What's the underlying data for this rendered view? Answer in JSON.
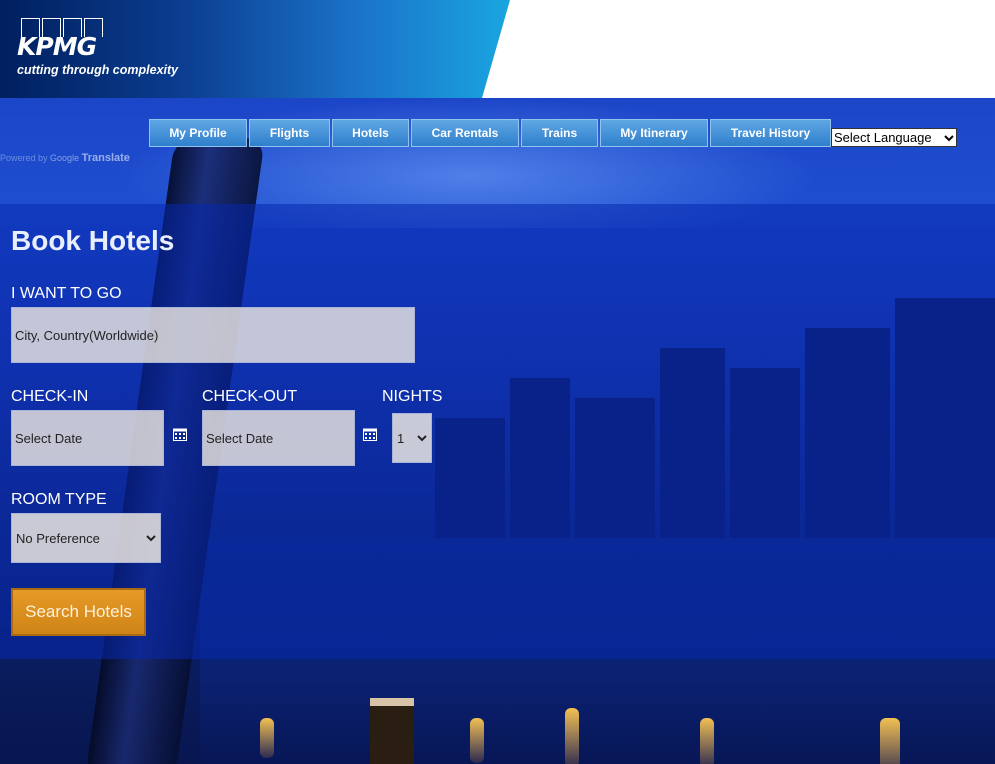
{
  "brand": {
    "name": "KPMG",
    "tagline": "cutting through complexity"
  },
  "nav": {
    "items": [
      {
        "label": "My Profile"
      },
      {
        "label": "Flights"
      },
      {
        "label": "Hotels"
      },
      {
        "label": "Car Rentals"
      },
      {
        "label": "Trains"
      },
      {
        "label": "My Itinerary"
      },
      {
        "label": "Travel History"
      }
    ],
    "language_select": "Select Language",
    "powered_by": "Powered by",
    "google": "Google",
    "translate": "Translate"
  },
  "booking": {
    "title": "Book Hotels",
    "destination": {
      "label": "I WANT TO GO",
      "value": "City, Country(Worldwide)"
    },
    "checkin": {
      "label": "CHECK-IN",
      "value": "Select Date"
    },
    "checkout": {
      "label": "CHECK-OUT",
      "value": "Select Date"
    },
    "nights": {
      "label": "NIGHTS",
      "value": "1"
    },
    "room_type": {
      "label": "ROOM TYPE",
      "value": "No Preference"
    },
    "search_button": "Search Hotels"
  },
  "colors": {
    "accent_orange": "#d88b1c",
    "nav_blue": "#3d8ad4",
    "panel_blue": "#0828af"
  }
}
